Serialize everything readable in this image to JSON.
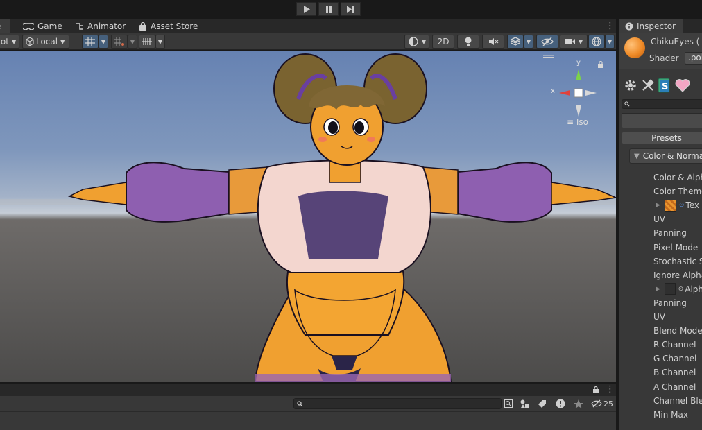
{
  "toolbar": {
    "play_label": "Play",
    "pause_label": "Pause",
    "step_label": "Step"
  },
  "tabs": {
    "scene_label": "e",
    "game_label": "Game",
    "animator_label": "Animator",
    "asset_store_label": "Asset Store"
  },
  "scene_toolbar": {
    "pivot_label": "ot",
    "space_label": "Local",
    "mode_2d_label": "2D"
  },
  "viewport": {
    "view_mode_label": "Iso",
    "gizmo_x_label": "x",
    "gizmo_y_label": "y"
  },
  "bottom_panel": {
    "search_placeholder": "",
    "hidden_count": "25"
  },
  "inspector": {
    "tab_label": "Inspector",
    "material_name": "ChikuEyes (",
    "shader_label": "Shader",
    "shader_value": ".poiy",
    "presets_label": "Presets",
    "section_label": "Color & Normals",
    "rows": [
      {
        "label": "Color & Alpha",
        "indent": 49,
        "kind": "text"
      },
      {
        "label": "Color Theme",
        "indent": 49,
        "kind": "text"
      },
      {
        "label": "Tex",
        "indent": 55,
        "kind": "texture"
      },
      {
        "label": "UV",
        "indent": 49,
        "kind": "text"
      },
      {
        "label": "Panning",
        "indent": 49,
        "kind": "text"
      },
      {
        "label": "Pixel Mode",
        "indent": 49,
        "kind": "text"
      },
      {
        "label": "Stochastic S",
        "indent": 49,
        "kind": "text"
      },
      {
        "label": "Ignore Alpha",
        "indent": 49,
        "kind": "text"
      },
      {
        "label": "Alph",
        "indent": 55,
        "kind": "emptytex"
      },
      {
        "label": "Panning",
        "indent": 49,
        "kind": "text"
      },
      {
        "label": "UV",
        "indent": 49,
        "kind": "text"
      },
      {
        "label": "Blend Mode",
        "indent": 49,
        "kind": "text"
      },
      {
        "label": "R Channel",
        "indent": 49,
        "kind": "text"
      },
      {
        "label": "G Channel",
        "indent": 49,
        "kind": "text"
      },
      {
        "label": "B Channel",
        "indent": 49,
        "kind": "text"
      },
      {
        "label": "A Channel",
        "indent": 49,
        "kind": "text"
      },
      {
        "label": "Channel Blen",
        "indent": 49,
        "kind": "text"
      },
      {
        "label": "Min Max",
        "indent": 49,
        "kind": "text"
      }
    ]
  },
  "colors": {
    "accent_blue": "#46607c",
    "material_orange": "#ef8a26",
    "gizmo_red": "#e0413b",
    "gizmo_green": "#7cd24a"
  }
}
